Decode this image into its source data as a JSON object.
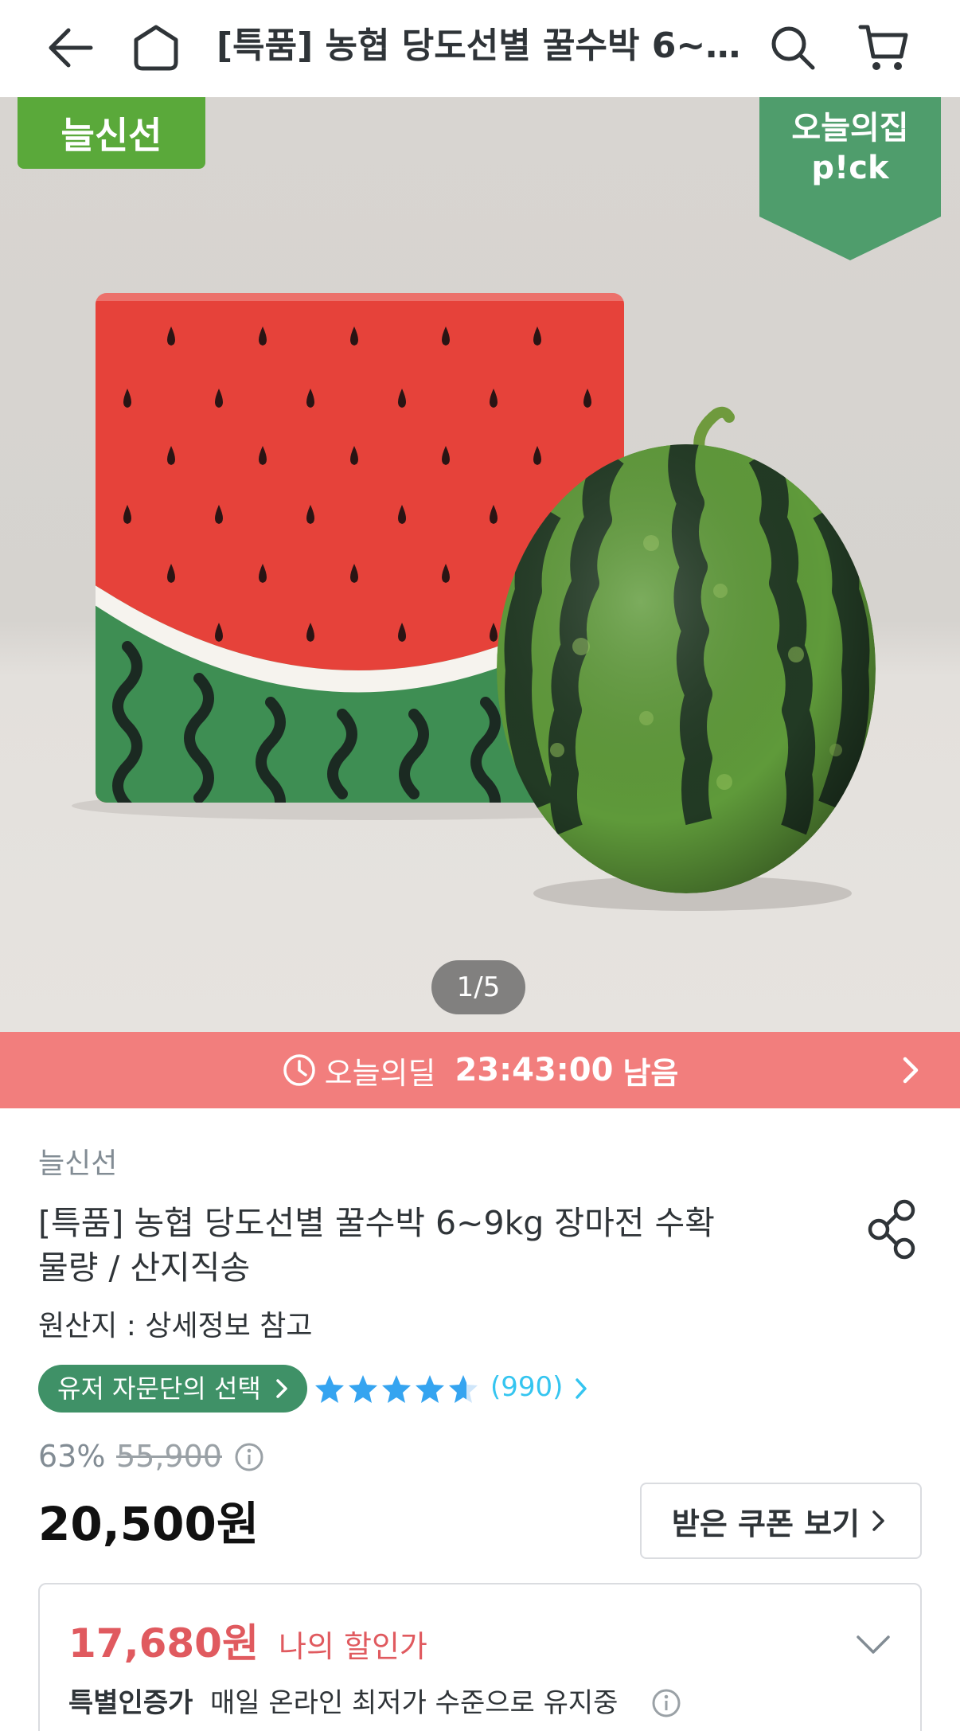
{
  "header": {
    "title": "[특품] 농협 당도선별 꿀수박 6~9k…",
    "icons": [
      "back-arrow-icon",
      "home-icon",
      "search-icon",
      "cart-icon"
    ]
  },
  "hero": {
    "badge_left": "늘신선",
    "badge_right_line1": "오늘의집",
    "badge_right_line2": "p!ck",
    "page_indicator": "1/5"
  },
  "deal": {
    "label": "오늘의딜",
    "time": "23:43:00",
    "remaining": "남음"
  },
  "product": {
    "brand": "늘신선",
    "title_line1": "[특품] 농협 당도선별 꿀수박 6~9kg 장마전 수확",
    "title_line2": "물량 / 산지직송",
    "origin": "원산지 : 상세정보 참고",
    "pill": "유저 자문단의 선택",
    "rating": 4.5,
    "review_count": "(990)",
    "discount": "63%",
    "original_price": "55,900",
    "price": "20,500원",
    "coupon_button": "받은 쿠폰 보기"
  },
  "my_price": {
    "price": "17,680원",
    "label": "나의 할인가",
    "special_label": "특별인증가",
    "special_text": "매일 온라인 최저가 수준으로 유지중"
  },
  "colors": {
    "deal_bar": "#f27e7d",
    "pill": "#3f9167",
    "brand_badge": "#5aa93a",
    "pick_badge": "#4f9d6c",
    "star": "#35a4f0",
    "my_price": "#e05a5f"
  }
}
